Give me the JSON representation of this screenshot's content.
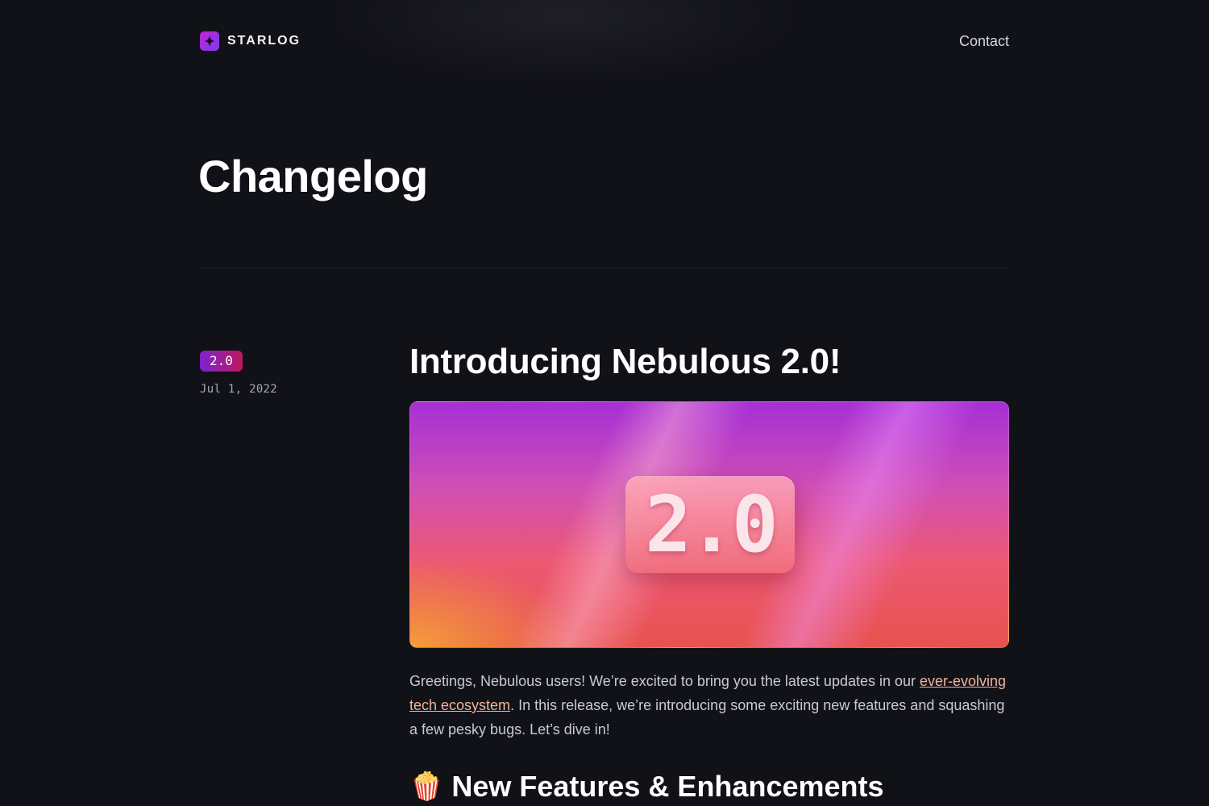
{
  "header": {
    "brand_name": "STARLOG",
    "nav": {
      "contact_label": "Contact"
    }
  },
  "page": {
    "title": "Changelog"
  },
  "entry": {
    "version": "2.0",
    "date": "Jul 1, 2022",
    "title": "Introducing Nebulous 2.0!",
    "hero_text": "2.0",
    "intro": {
      "text_before": "Greetings, Nebulous users! We’re excited to bring you the latest updates in our ",
      "link_text": "ever-evolving tech ecosystem",
      "text_after": ". In this release, we’re introducing some exciting new features and squashing a few pesky bugs. Let’s dive in!"
    },
    "section_heading": {
      "icon": "popcorn-icon",
      "emoji": "🍿",
      "text": "New Features & Enhancements"
    }
  },
  "colors": {
    "background": "#111218",
    "accent_link": "#f3b39a",
    "badge_gradient_start": "#7e22ce",
    "badge_gradient_end": "#be185d"
  }
}
